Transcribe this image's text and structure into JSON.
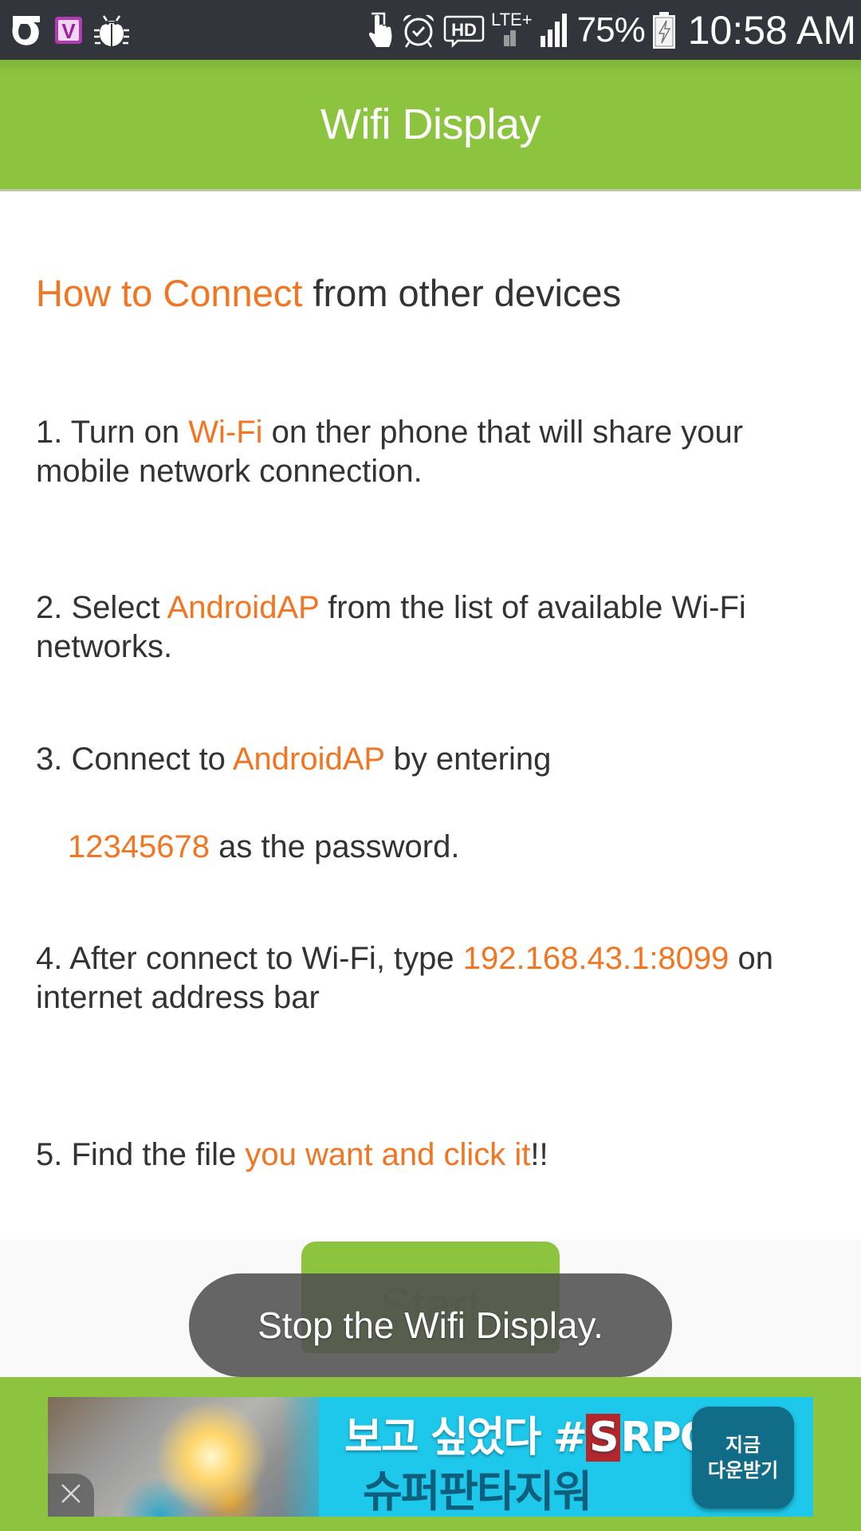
{
  "status_bar": {
    "left_icons": [
      "carrier-logo-icon",
      "v-app-icon",
      "debug-bug-icon"
    ],
    "right_icons": [
      "touch-icon",
      "alarm-icon",
      "hd-voice-icon",
      "lte-plus-icon",
      "signal-icon",
      "battery-charging-icon"
    ],
    "lte_label": "LTE+",
    "hd_label": "HD",
    "battery_percent": "75%",
    "time": "10:58 AM"
  },
  "app_bar": {
    "title": "Wifi Display"
  },
  "content": {
    "heading": {
      "highlight": "How to Connect",
      "rest": " from other devices"
    },
    "steps": [
      {
        "prefix": "1. Turn on ",
        "highlight": "Wi-Fi",
        "suffix": " on ther phone that will share your mobile network connection."
      },
      {
        "prefix": "2. Select ",
        "highlight": "AndroidAP",
        "suffix": " from the list of available Wi-Fi networks."
      },
      {
        "prefix": "3. Connect to ",
        "highlight": "AndroidAP",
        "suffix": " by entering"
      },
      {
        "prefix": "",
        "highlight": "12345678",
        "suffix": " as the password."
      },
      {
        "prefix": "4. After connect to Wi-Fi, type ",
        "highlight": "192.168.43.1:8099",
        "suffix": " on internet address bar"
      },
      {
        "prefix": "5. Find the file ",
        "highlight": "you want and click it",
        "suffix": "!!"
      }
    ]
  },
  "start_button": {
    "label": "Start"
  },
  "toast": {
    "message": "Stop the Wifi Display."
  },
  "ad": {
    "line1_prefix": "보고 싶었다 #",
    "line1_s": "S",
    "line1_suffix": "RPG",
    "line2": "슈퍼판타지워",
    "cta_line1": "지금",
    "cta_line2": "다운받기",
    "close_icon": "close-icon"
  },
  "colors": {
    "accent_green": "#8cc43f",
    "highlight_orange": "#f47521",
    "text_dark": "#333333",
    "status_bar_bg": "#32353b",
    "toast_bg": "#505050"
  }
}
